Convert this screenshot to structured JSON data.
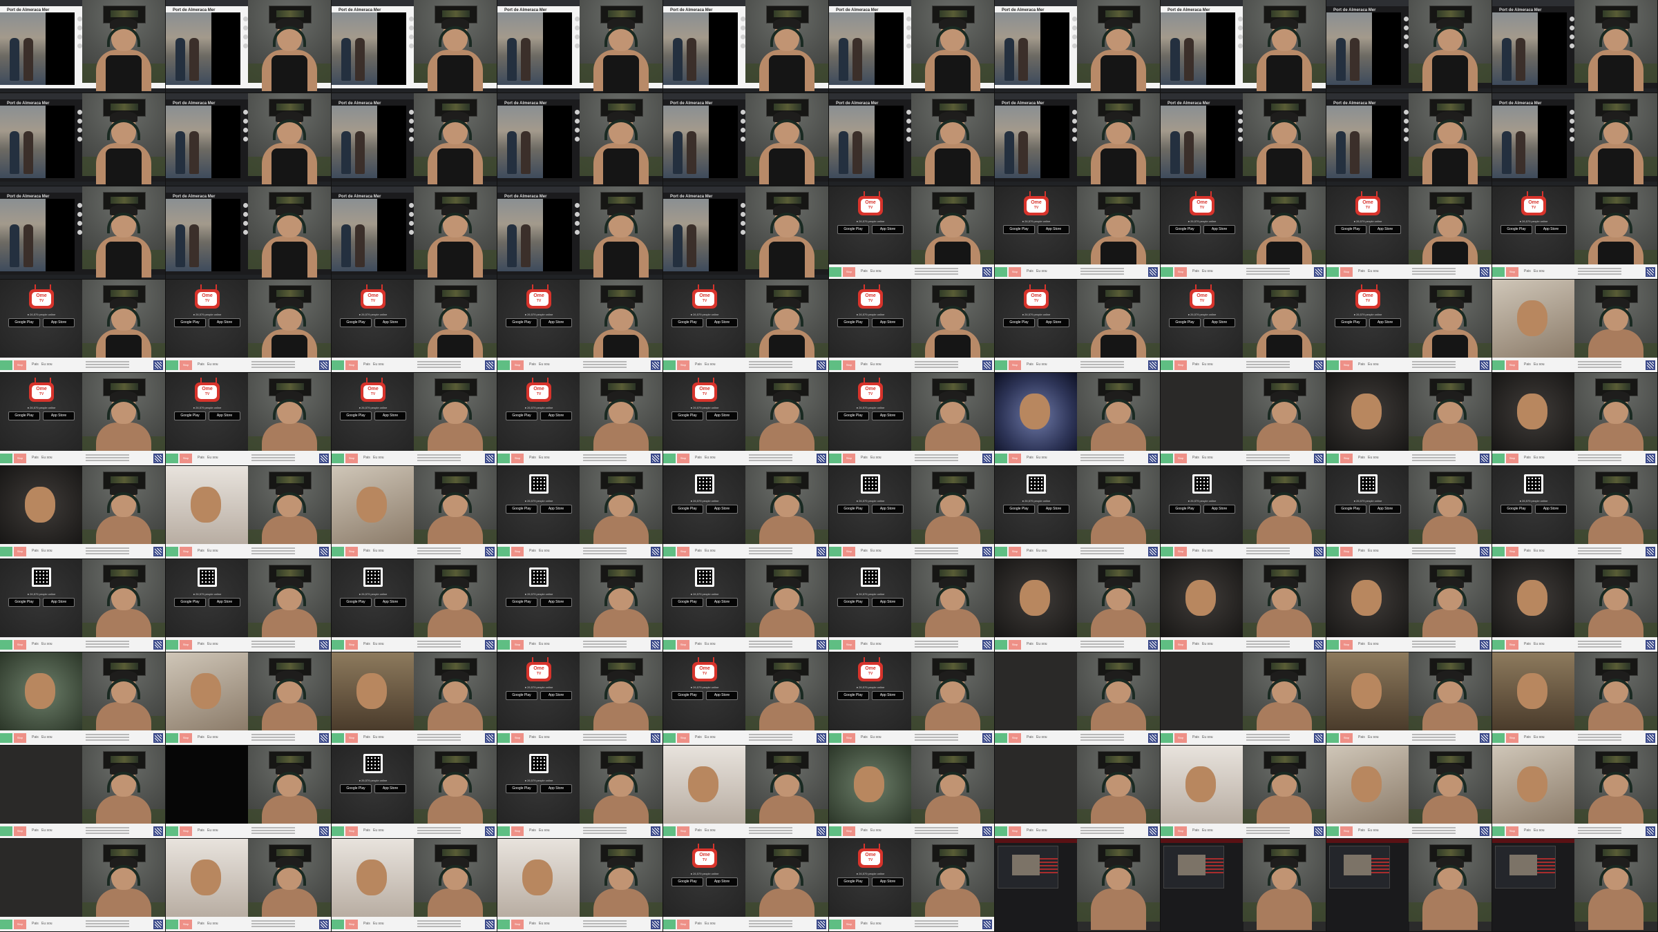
{
  "browser": {
    "page_title": "Port de Almeraca Mer",
    "taskbar": "",
    "controls": [
      "minimize",
      "maximize",
      "close"
    ]
  },
  "ometv": {
    "logo_line1": "Ome",
    "logo_line2": "TV",
    "online": "● 26,579 people online",
    "google_play": "Google Play",
    "app_store": "App Store"
  },
  "chat": {
    "stop_label": "Stop",
    "country_label": "Pais",
    "gender_label": "Eu sou"
  },
  "tiles": [
    {
      "left": "browser",
      "cam": "tank"
    },
    {
      "left": "browser",
      "cam": "tank"
    },
    {
      "left": "browser",
      "cam": "tank"
    },
    {
      "left": "browser",
      "cam": "tank"
    },
    {
      "left": "browser",
      "cam": "tank"
    },
    {
      "left": "browser",
      "cam": "tank"
    },
    {
      "left": "browser",
      "cam": "tank"
    },
    {
      "left": "browser",
      "cam": "tank"
    },
    {
      "left": "browser-dark",
      "cam": "tank"
    },
    {
      "left": "browser-dark",
      "cam": "tank"
    },
    {
      "left": "browser-dark",
      "cam": "tank"
    },
    {
      "left": "browser-dark",
      "cam": "tank"
    },
    {
      "left": "browser-dark",
      "cam": "tank"
    },
    {
      "left": "browser-dark",
      "cam": "tank"
    },
    {
      "left": "browser-dark",
      "cam": "tank"
    },
    {
      "left": "browser-dark",
      "cam": "tank"
    },
    {
      "left": "browser-dark",
      "cam": "tank"
    },
    {
      "left": "browser-dark",
      "cam": "tank"
    },
    {
      "left": "browser-dark",
      "cam": "tank"
    },
    {
      "left": "browser-dark",
      "cam": "tank"
    },
    {
      "left": "browser-dark",
      "cam": "tank"
    },
    {
      "left": "browser-dark",
      "cam": "tank"
    },
    {
      "left": "browser-dark",
      "cam": "tank"
    },
    {
      "left": "browser-dark",
      "cam": "tank"
    },
    {
      "left": "browser-dark",
      "cam": "tank"
    },
    {
      "left": "splash",
      "cam": "tank"
    },
    {
      "left": "splash",
      "cam": "tank"
    },
    {
      "left": "splash",
      "cam": "tank"
    },
    {
      "left": "splash",
      "cam": "tank"
    },
    {
      "left": "splash",
      "cam": "tank"
    },
    {
      "left": "splash",
      "cam": "tank"
    },
    {
      "left": "splash",
      "cam": "tank"
    },
    {
      "left": "splash",
      "cam": "tank"
    },
    {
      "left": "splash",
      "cam": "tank"
    },
    {
      "left": "splash",
      "cam": "tank"
    },
    {
      "left": "splash",
      "cam": "tank"
    },
    {
      "left": "splash",
      "cam": "tank"
    },
    {
      "left": "splash",
      "cam": "tank"
    },
    {
      "left": "splash",
      "cam": "tank"
    },
    {
      "left": "s-warm",
      "cam": "bare"
    },
    {
      "left": "splash",
      "cam": "bare"
    },
    {
      "left": "splash",
      "cam": "bare"
    },
    {
      "left": "splash",
      "cam": "bare"
    },
    {
      "left": "splash",
      "cam": "bare"
    },
    {
      "left": "splash",
      "cam": "bare"
    },
    {
      "left": "splash",
      "cam": "bare"
    },
    {
      "left": "s-blurblue",
      "cam": "bare"
    },
    {
      "left": "s-dark",
      "cam": "bare"
    },
    {
      "left": "s-dim",
      "cam": "bare"
    },
    {
      "left": "s-dim",
      "cam": "bare"
    },
    {
      "left": "s-dim",
      "cam": "bare"
    },
    {
      "left": "s-pale",
      "cam": "bare"
    },
    {
      "left": "s-warm",
      "cam": "bare"
    },
    {
      "left": "splash-qr",
      "cam": "bare"
    },
    {
      "left": "splash-qr",
      "cam": "bare"
    },
    {
      "left": "splash-qr",
      "cam": "bare"
    },
    {
      "left": "splash-qr",
      "cam": "bare"
    },
    {
      "left": "splash-qr",
      "cam": "bare"
    },
    {
      "left": "splash-qr",
      "cam": "bare"
    },
    {
      "left": "splash-qr",
      "cam": "bare"
    },
    {
      "left": "splash-qr",
      "cam": "bare"
    },
    {
      "left": "splash-qr",
      "cam": "bare"
    },
    {
      "left": "splash-qr",
      "cam": "bare"
    },
    {
      "left": "splash-qr",
      "cam": "bare"
    },
    {
      "left": "splash-qr",
      "cam": "bare"
    },
    {
      "left": "splash-qr",
      "cam": "bare"
    },
    {
      "left": "s-dim",
      "cam": "bare"
    },
    {
      "left": "s-dim",
      "cam": "bare"
    },
    {
      "left": "s-dim",
      "cam": "bare"
    },
    {
      "left": "s-dim",
      "cam": "bare"
    },
    {
      "left": "s-green",
      "cam": "bare"
    },
    {
      "left": "s-warm",
      "cam": "bare"
    },
    {
      "left": "s-room",
      "cam": "bare"
    },
    {
      "left": "splash",
      "cam": "bare"
    },
    {
      "left": "splash",
      "cam": "bare"
    },
    {
      "left": "splash",
      "cam": "bare"
    },
    {
      "left": "s-dark",
      "cam": "bare"
    },
    {
      "left": "s-dark",
      "cam": "bare"
    },
    {
      "left": "s-room",
      "cam": "bare"
    },
    {
      "left": "s-room",
      "cam": "bare"
    },
    {
      "left": "s-dark",
      "cam": "bare"
    },
    {
      "left": "s-black",
      "cam": "bare"
    },
    {
      "left": "splash-qr",
      "cam": "bare"
    },
    {
      "left": "splash-qr",
      "cam": "bare"
    },
    {
      "left": "s-pale",
      "cam": "bare"
    },
    {
      "left": "s-green",
      "cam": "bare"
    },
    {
      "left": "s-dark",
      "cam": "bare"
    },
    {
      "left": "s-pale",
      "cam": "bare"
    },
    {
      "left": "s-warm",
      "cam": "bare"
    },
    {
      "left": "s-warm",
      "cam": "bare"
    },
    {
      "left": "s-dark",
      "cam": "bare"
    },
    {
      "left": "s-pale",
      "cam": "bare"
    },
    {
      "left": "s-pale",
      "cam": "bare"
    },
    {
      "left": "s-pale",
      "cam": "bare"
    },
    {
      "left": "splash",
      "cam": "bare"
    },
    {
      "left": "splash",
      "cam": "bare"
    },
    {
      "left": "dash",
      "cam": "bare"
    },
    {
      "left": "dash",
      "cam": "bare"
    },
    {
      "left": "dash",
      "cam": "bare"
    },
    {
      "left": "dash",
      "cam": "bare"
    }
  ],
  "colors": {
    "ome_red": "#d8342c",
    "start_green": "#5fbe83",
    "stop_red": "#ee9087",
    "splash_bg": "#242424"
  }
}
